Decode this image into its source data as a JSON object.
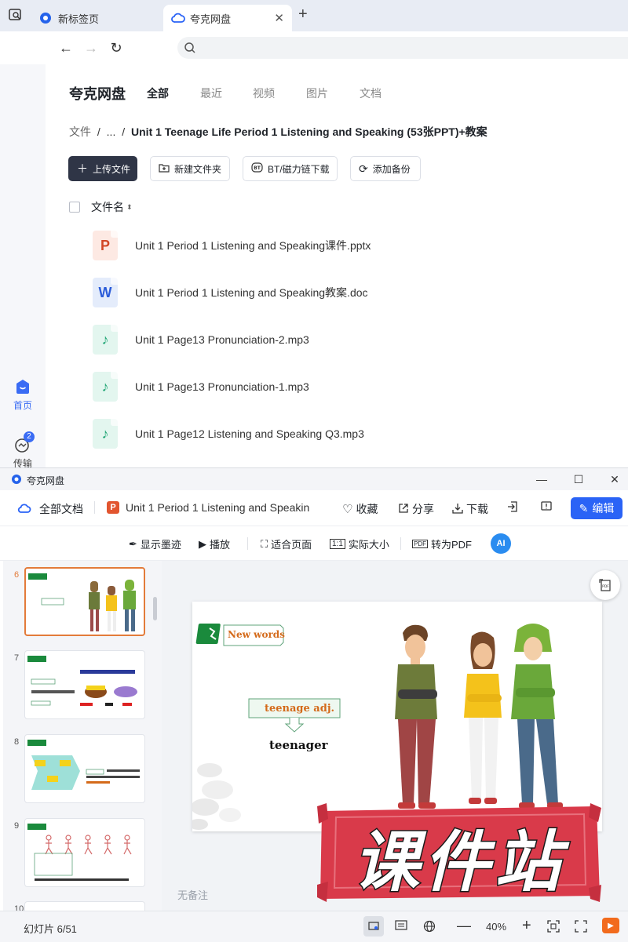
{
  "browser": {
    "tabs": [
      {
        "label": "新标签页",
        "active": false
      },
      {
        "label": "夸克网盘",
        "active": true
      }
    ],
    "new_tab_symbol": "+",
    "close_symbol": "✕"
  },
  "rail": {
    "home_label": "首页",
    "transfer_label": "传输",
    "transfer_badge": "2"
  },
  "pan": {
    "brand": "夸克网盘",
    "categories": [
      "全部",
      "最近",
      "视频",
      "图片",
      "文档"
    ],
    "breadcrumb": {
      "root": "文件",
      "sep": "/",
      "ellipsis": "...",
      "current": "Unit 1 Teenage Life Period 1 Listening and Speaking (53张PPT)+教案"
    },
    "toolbar": {
      "upload": "上传文件",
      "new_folder": "新建文件夹",
      "bt_download": "BT/磁力链下载",
      "add_backup": "添加备份"
    },
    "column_header": "文件名",
    "files": [
      {
        "name": "Unit 1 Period 1 Listening and Speaking课件.pptx",
        "type": "ppt",
        "glyph": "P"
      },
      {
        "name": "Unit 1 Period 1 Listening and Speaking教案.doc",
        "type": "doc",
        "glyph": "W"
      },
      {
        "name": "Unit 1 Page13 Pronunciation-2.mp3",
        "type": "mp3",
        "glyph": "♪"
      },
      {
        "name": "Unit 1 Page13 Pronunciation-1.mp3",
        "type": "mp3",
        "glyph": "♪"
      },
      {
        "name": "Unit 1 Page12 Listening and Speaking Q3.mp3",
        "type": "mp3",
        "glyph": "♪"
      }
    ]
  },
  "viewer": {
    "window_title": "夸克网盘",
    "header": {
      "all_docs": "全部文档",
      "doc_title": "Unit 1 Period 1 Listening and Speakin",
      "favorite": "收藏",
      "share": "分享",
      "download": "下载",
      "edit": "编辑"
    },
    "tools": {
      "show_ink": "显示墨迹",
      "play": "播放",
      "fit_page": "适合页面",
      "actual_size": "实际大小",
      "to_pdf": "转为PDF",
      "ai": "AI"
    },
    "thumbnails": [
      {
        "num": "6",
        "active": true
      },
      {
        "num": "7",
        "active": false
      },
      {
        "num": "8",
        "active": false
      },
      {
        "num": "9",
        "active": false
      },
      {
        "num": "10",
        "active": false
      }
    ],
    "slide": {
      "badge": "New words",
      "term": "teenage adj.",
      "word": "teenager"
    },
    "notes_placeholder": "无备注",
    "status": {
      "slide_counter": "幻灯片 6/51",
      "zoom": "40%"
    }
  },
  "watermark_text": "课件站",
  "colors": {
    "accent": "#2a63f6",
    "primary_dark": "#2f3546",
    "thumb_active": "#e37b3a",
    "watermark": "#d93a4a"
  }
}
